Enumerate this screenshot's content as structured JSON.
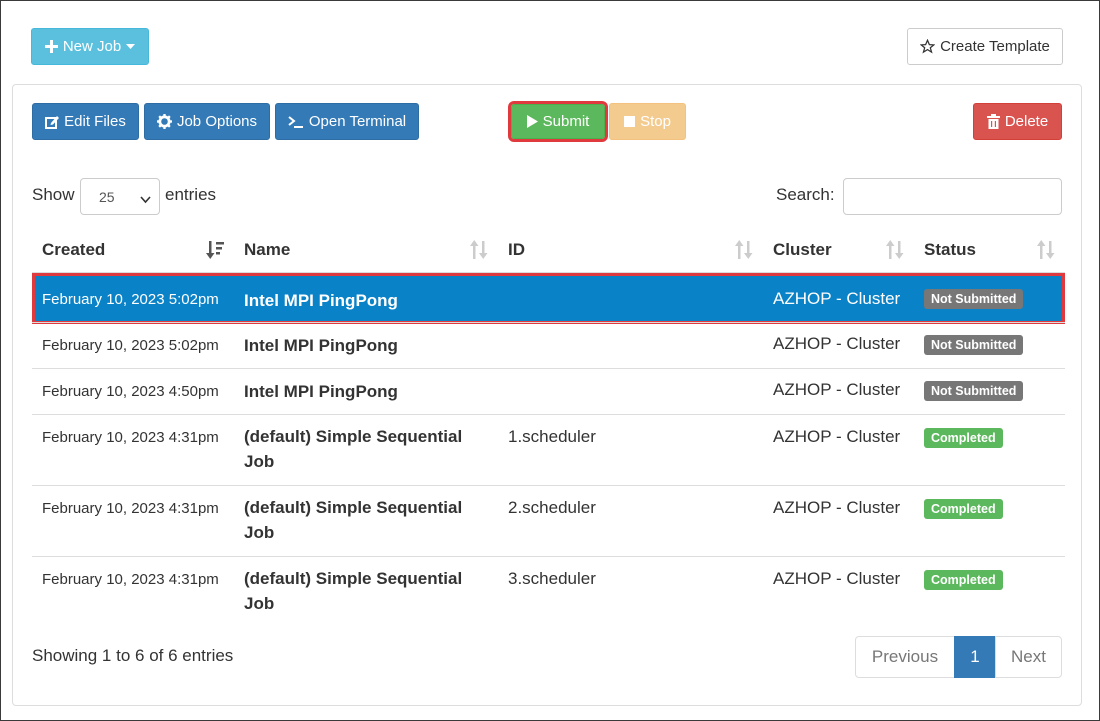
{
  "toolbar_top": {
    "new_job_label": "New Job",
    "create_template_label": "Create Template"
  },
  "actions": {
    "edit_files": "Edit Files",
    "job_options": "Job Options",
    "open_terminal": "Open Terminal",
    "submit": "Submit",
    "stop": "Stop",
    "delete": "Delete"
  },
  "length": {
    "show_label": "Show",
    "value": "25",
    "entries_label": "entries"
  },
  "search": {
    "label": "Search:",
    "value": ""
  },
  "table": {
    "columns": [
      "Created",
      "Name",
      "ID",
      "Cluster",
      "Status"
    ],
    "rows": [
      {
        "created": "February 10, 2023 5:02pm",
        "name": "Intel MPI PingPong",
        "id": "",
        "cluster": "AZHOP - Cluster",
        "status": "Not Submitted",
        "selected": true
      },
      {
        "created": "February 10, 2023 5:02pm",
        "name": "Intel MPI PingPong",
        "id": "",
        "cluster": "AZHOP - Cluster",
        "status": "Not Submitted",
        "selected": false
      },
      {
        "created": "February 10, 2023 4:50pm",
        "name": "Intel MPI PingPong",
        "id": "",
        "cluster": "AZHOP - Cluster",
        "status": "Not Submitted",
        "selected": false
      },
      {
        "created": "February 10, 2023 4:31pm",
        "name": "(default) Simple Sequential Job",
        "id": "1.scheduler",
        "cluster": "AZHOP - Cluster",
        "status": "Completed",
        "selected": false
      },
      {
        "created": "February 10, 2023 4:31pm",
        "name": "(default) Simple Sequential Job",
        "id": "2.scheduler",
        "cluster": "AZHOP - Cluster",
        "status": "Completed",
        "selected": false
      },
      {
        "created": "February 10, 2023 4:31pm",
        "name": "(default) Simple Sequential Job",
        "id": "3.scheduler",
        "cluster": "AZHOP - Cluster",
        "status": "Completed",
        "selected": false
      }
    ]
  },
  "footer": {
    "info": "Showing 1 to 6 of 6 entries",
    "previous": "Previous",
    "page": "1",
    "next": "Next"
  },
  "colors": {
    "primary": "#337ab7",
    "info": "#5bc0de",
    "success": "#5cb85c",
    "warning": "#f0ad4e",
    "danger": "#d9534f",
    "selected_row": "#0a82c7",
    "highlight_outline": "#e0393e"
  },
  "icons": {
    "new_job": "plus-icon",
    "create_template": "star-icon",
    "edit_files": "edit-icon",
    "job_options": "gear-icon",
    "open_terminal": "terminal-icon",
    "submit": "play-icon",
    "stop": "stop-icon",
    "delete": "trash-icon"
  }
}
